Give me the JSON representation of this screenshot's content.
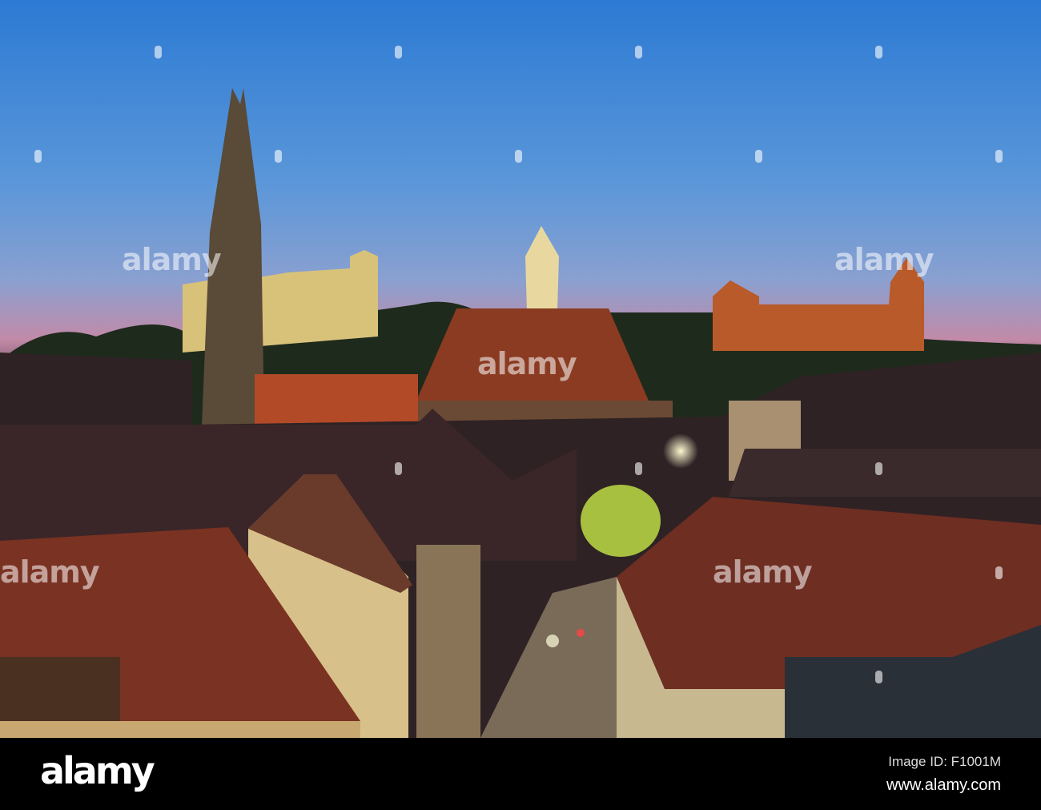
{
  "watermark": "alamy",
  "footer": {
    "logo": "alamy",
    "image_id": "Image ID: F1001M",
    "website": "www.alamy.com"
  },
  "colors": {
    "sky_top": "#2f7fd6",
    "sky_mid": "#6c9fd8",
    "sky_horizon": "#c98aa6",
    "roof": "#8a3a22",
    "glow": "#f0c860"
  }
}
